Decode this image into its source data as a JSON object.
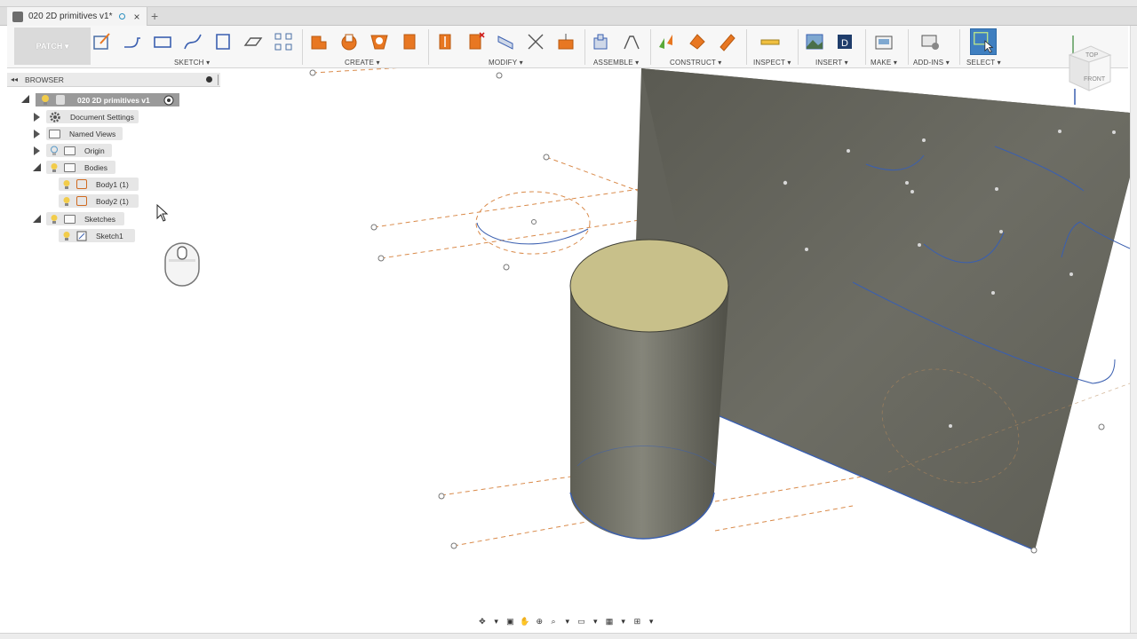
{
  "document": {
    "tab_title": "020 2D primitives v1*",
    "tab_close": "×",
    "new_tab": "+"
  },
  "toolbar": {
    "workspace": "PATCH ▾",
    "groups": {
      "sketch": "SKETCH ▾",
      "create": "CREATE ▾",
      "modify": "MODIFY ▾",
      "assemble": "ASSEMBLE ▾",
      "construct": "CONSTRUCT ▾",
      "inspect": "INSPECT ▾",
      "insert": "INSERT ▾",
      "make": "MAKE ▾",
      "addins": "ADD-INS ▾",
      "select": "SELECT ▾"
    },
    "accent_color": "#e87722",
    "select_color": "#3f7fc0"
  },
  "browser": {
    "title": "BROWSER",
    "root": "020 2D primitives v1",
    "items": [
      {
        "label": "Document Settings",
        "icon": "gear-icon"
      },
      {
        "label": "Named Views",
        "icon": "folder-icon"
      },
      {
        "label": "Origin",
        "icon": "folder-icon"
      },
      {
        "label": "Bodies",
        "icon": "folder-icon"
      },
      {
        "label": "Body1 (1)",
        "icon": "body-icon"
      },
      {
        "label": "Body2 (1)",
        "icon": "body-icon"
      },
      {
        "label": "Sketches",
        "icon": "folder-icon"
      },
      {
        "label": "Sketch1",
        "icon": "sketch-icon"
      }
    ]
  },
  "viewcube": {
    "top": "TOP",
    "front": "FRONT"
  },
  "colors": {
    "surface": "#626258",
    "cylinder_inner": "#c8c08a",
    "sketch_line_orange": "#d98a4a",
    "sketch_line_blue": "#3a5fb0"
  }
}
